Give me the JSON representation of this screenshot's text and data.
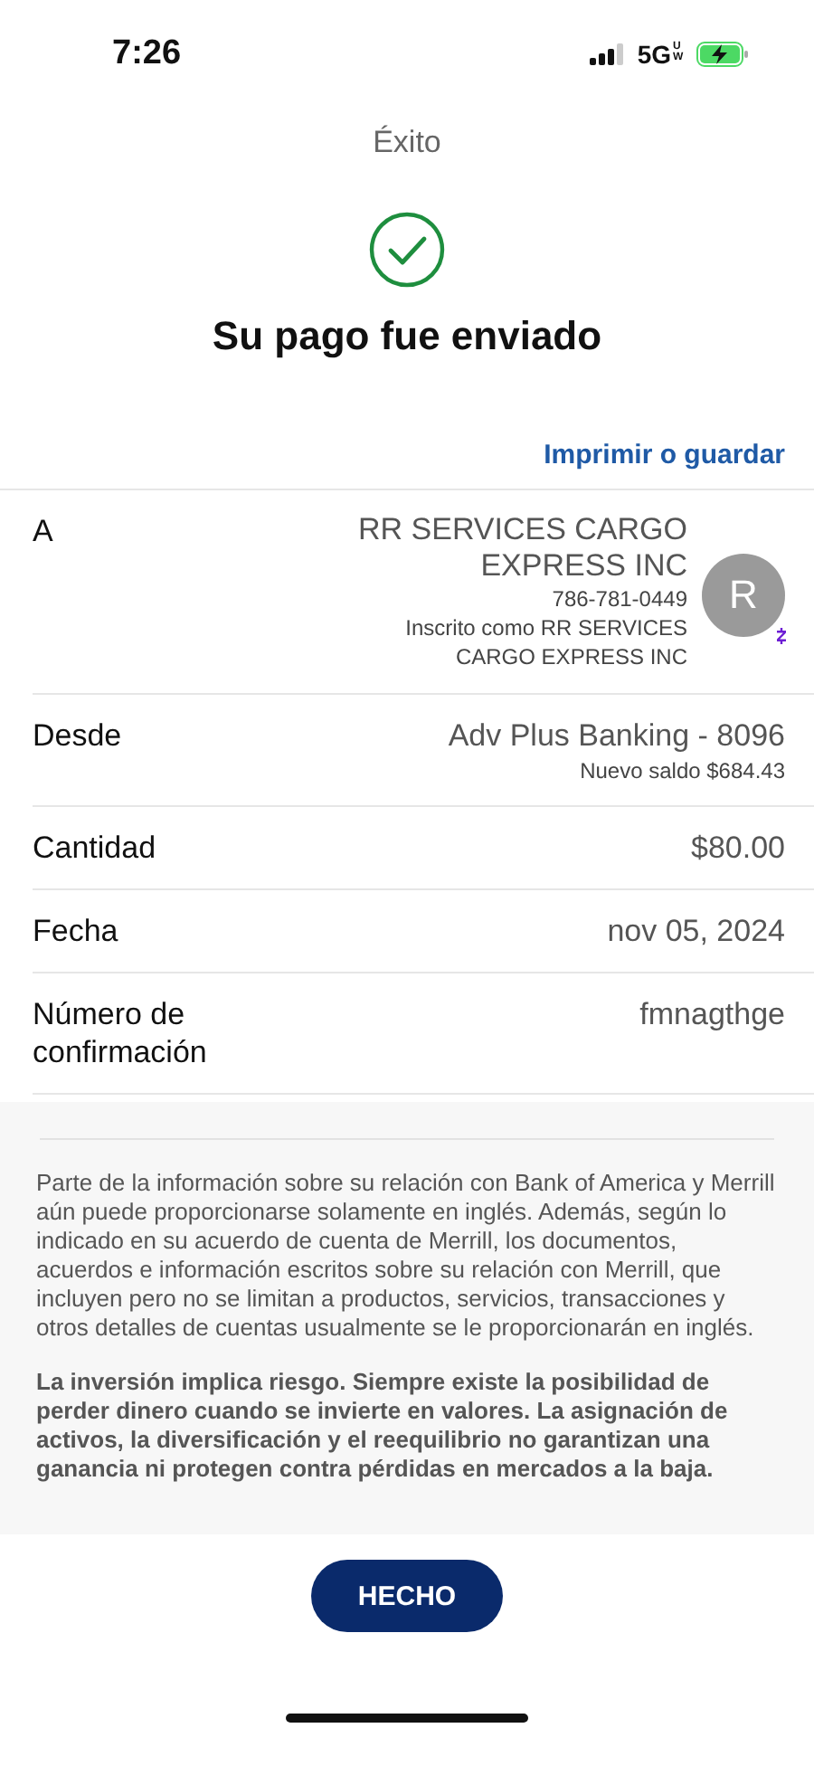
{
  "status_bar": {
    "time": "7:26",
    "network": "5G",
    "network_badge": "UW"
  },
  "header": {
    "title": "Éxito"
  },
  "confirmation": {
    "heading": "Su pago fue enviado"
  },
  "print_link": "Imprimir o guardar",
  "details": [
    {
      "kind": "recipient",
      "label": "A",
      "name": "RR SERVICES CARGO EXPRESS INC",
      "phone": "786-781-0449",
      "enrolled_as": "Inscrito como RR SERVICES CARGO EXPRESS INC",
      "avatar_initial": "R"
    },
    {
      "kind": "account",
      "label": "Desde",
      "value": "Adv Plus Banking - 8096",
      "note": "Nuevo saldo $684.43"
    },
    {
      "kind": "plain",
      "label": "Cantidad",
      "value": "$80.00"
    },
    {
      "kind": "plain",
      "label": "Fecha",
      "value": "nov 05, 2024"
    },
    {
      "kind": "plain",
      "label": "Número de confirmación",
      "value": "fmnagthge"
    }
  ],
  "disclosures": [
    {
      "kind": "plain",
      "text": "Parte de la información sobre su relación con Bank of America y Merrill aún puede proporcionarse solamente en inglés. Además, según lo indicado en su acuerdo de cuenta de Merrill, los documentos, acuerdos e información escritos sobre su relación con Merrill, que incluyen pero no se limitan a productos, servicios, transacciones y otros detalles de cuentas usualmente se le proporcionarán en inglés."
    },
    {
      "kind": "strong",
      "text": "La inversión implica riesgo. Siempre existe la posibilidad de perder dinero cuando se invierte en valores. La asignación de activos, la diversificación y el reequilibrio no garantizan una ganancia ni protegen contra pérdidas en mercados a la baja."
    }
  ],
  "done_button": "HECHO"
}
